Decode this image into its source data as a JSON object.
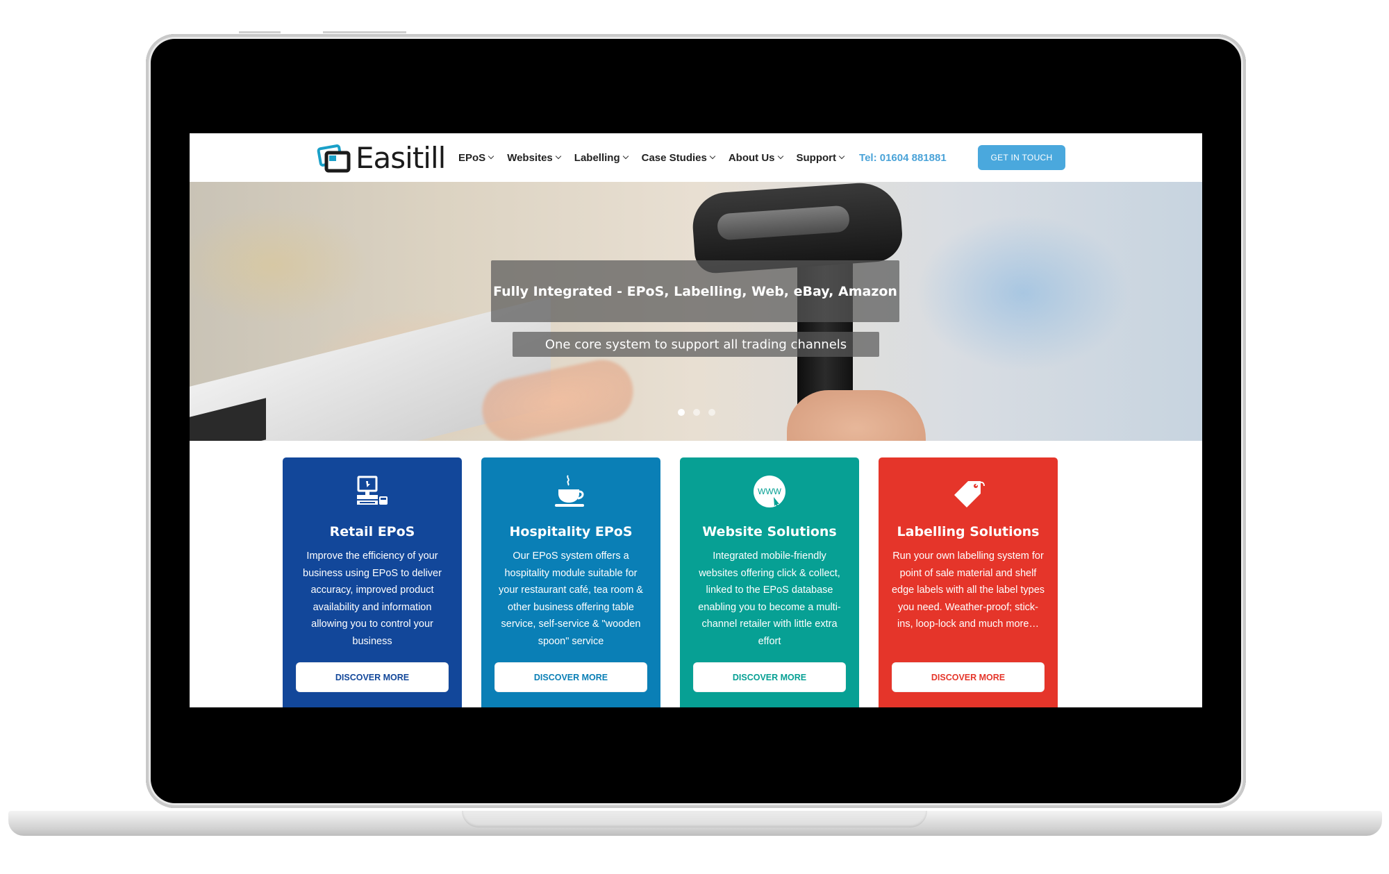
{
  "brand": {
    "name": "Easitill"
  },
  "nav": {
    "items": [
      {
        "label": "EPoS"
      },
      {
        "label": "Websites"
      },
      {
        "label": "Labelling"
      },
      {
        "label": "Case Studies"
      },
      {
        "label": "About Us"
      },
      {
        "label": "Support"
      }
    ],
    "phone": "Tel: 01604 881881",
    "cta": "GET IN TOUCH"
  },
  "hero": {
    "title": "Fully Integrated - EPoS, Labelling, Web, eBay, Amazon",
    "subtitle": "One core system to support all trading channels",
    "slides_total": 3,
    "active_slide": 1
  },
  "cards": [
    {
      "icon": "epos-terminal-icon",
      "title": "Retail EPoS",
      "desc": "Improve the efficiency of your business using EPoS to deliver accuracy, improved product availability and information allowing you to control your business",
      "button": "DISCOVER MORE",
      "color": "#12479a"
    },
    {
      "icon": "coffee-cup-icon",
      "title": "Hospitality EPoS",
      "desc": "Our EPoS system offers a hospitality module suitable for your restaurant café, tea room & other business offering table service, self-service & \"wooden spoon\" service",
      "button": "DISCOVER MORE",
      "color": "#0a7fb6"
    },
    {
      "icon": "www-globe-icon",
      "title": "Website Solutions",
      "desc": "Integrated mobile-friendly websites offering click & collect, linked to the EPoS database enabling you to become a multi-channel retailer with little extra effort",
      "button": "DISCOVER MORE",
      "color": "#07a094"
    },
    {
      "icon": "price-tag-icon",
      "title": "Labelling Solutions",
      "desc": "Run your own labelling system for point of sale material and shelf edge labels with all the label types you need. Weather-proof; stick-ins, loop-lock and much more…",
      "button": "DISCOVER MORE",
      "color": "#e5352a"
    }
  ],
  "colors": {
    "accent": "#4aa8dd",
    "phone": "#4aa3d8"
  }
}
